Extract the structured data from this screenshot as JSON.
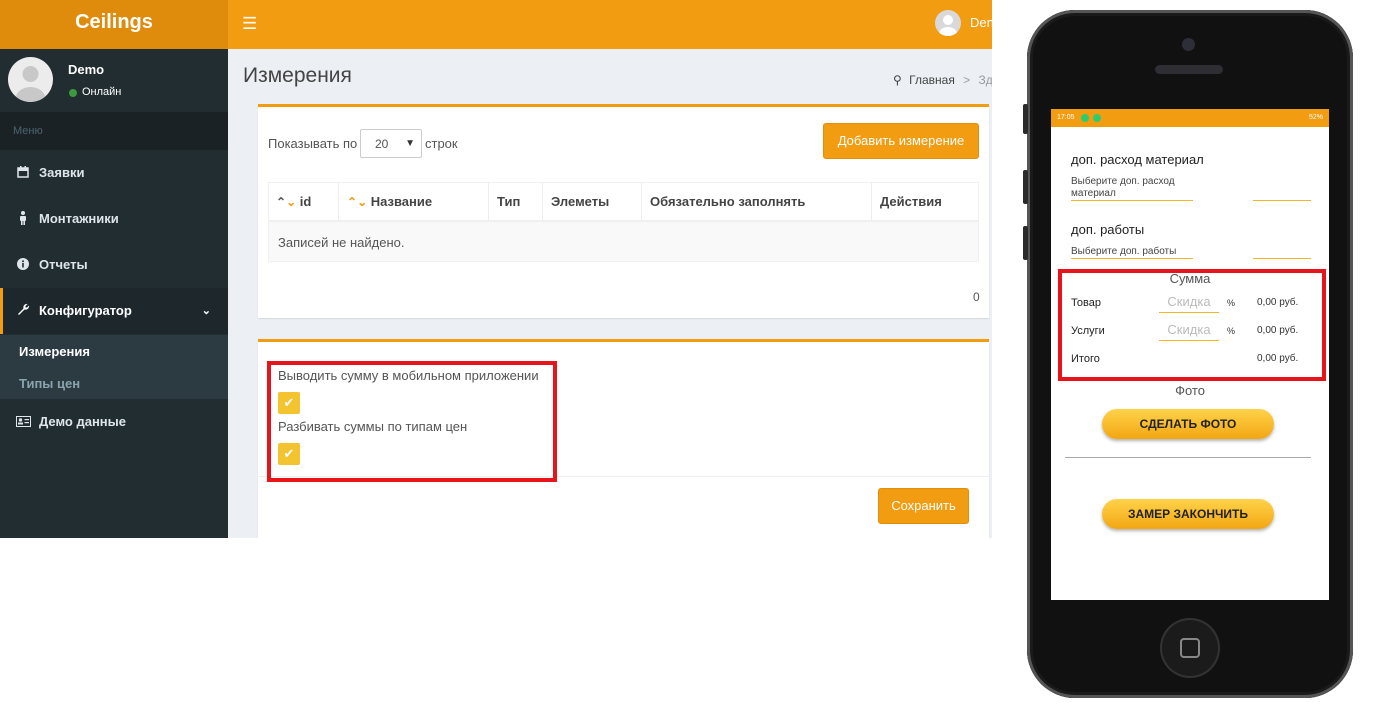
{
  "admin": {
    "logo": "Ceilings",
    "topbar": {
      "menu_icon": "hamburger-icon",
      "user_short": "Den"
    },
    "user": {
      "name": "Demo",
      "status": "Онлайн"
    },
    "menu_header": "Меню",
    "nav": [
      {
        "label": "Заявки",
        "icon": "calendar-icon"
      },
      {
        "label": "Монтажники",
        "icon": "person-icon"
      },
      {
        "label": "Отчеты",
        "icon": "info-icon"
      },
      {
        "label": "Конфигуратор",
        "icon": "wrench-icon",
        "active": true
      },
      {
        "label": "Демо данные",
        "icon": "id-card-icon"
      }
    ],
    "submenu": [
      {
        "label": "Измерения",
        "active": true
      },
      {
        "label": "Типы цен"
      }
    ],
    "page_title": "Измерения",
    "breadcrumb": {
      "home": "Главная",
      "separator": ">",
      "current": "Зде"
    },
    "list": {
      "show_label": "Показывать по",
      "rows_value": "20",
      "rows_label": "строк",
      "add_button": "Добавить измерение",
      "columns": [
        "id",
        "Название",
        "Тип",
        "Элеметы",
        "Обязательно заполнять",
        "Действия"
      ],
      "empty_text": "Записей не найдено.",
      "count": "0"
    },
    "settings": {
      "option1_label": "Выводить сумму в мобильном приложении",
      "option1_checked": true,
      "option2_label": "Разбивать суммы по типам цен",
      "option2_checked": true,
      "save_button": "Сохранить"
    },
    "colors": {
      "accent": "#f29c12",
      "sidebar": "#222d32",
      "highlight": "#e8141b"
    }
  },
  "mobile": {
    "status_time": "17:05",
    "status_battery": "52%",
    "extra_material_label": "доп. расход материал",
    "extra_material_hint": "Выберите доп. расход материал",
    "extra_work_label": "доп. работы",
    "extra_work_hint": "Выберите доп. работы",
    "sum_title": "Сумма",
    "rows": [
      {
        "label": "Товар",
        "discount_placeholder": "Скидка",
        "percent": "%",
        "value": "0,00 руб."
      },
      {
        "label": "Услуги",
        "discount_placeholder": "Скидка",
        "percent": "%",
        "value": "0,00 руб."
      },
      {
        "label": "Итого",
        "value": "0,00 руб."
      }
    ],
    "photo_title": "Фото",
    "take_photo_button": "СДЕЛАТЬ ФОТО",
    "finish_button": "ЗАМЕР ЗАКОНЧИТЬ"
  }
}
